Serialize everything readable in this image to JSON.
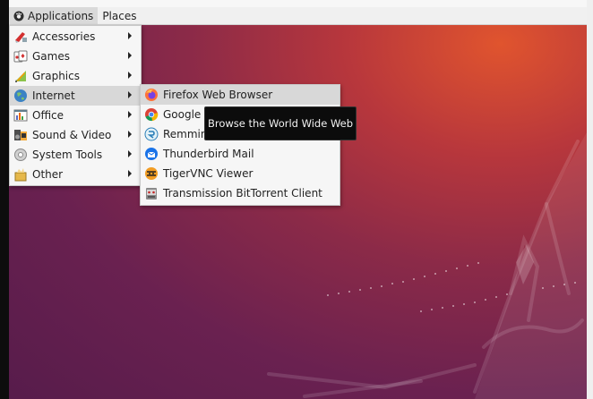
{
  "topbar": {
    "menus": [
      {
        "label": "Applications",
        "active": true
      },
      {
        "label": "Places",
        "active": false
      }
    ]
  },
  "categories": [
    {
      "label": "Accessories",
      "icon": "accessories-icon"
    },
    {
      "label": "Games",
      "icon": "games-icon"
    },
    {
      "label": "Graphics",
      "icon": "graphics-icon"
    },
    {
      "label": "Internet",
      "icon": "internet-icon",
      "highlighted": true
    },
    {
      "label": "Office",
      "icon": "office-icon"
    },
    {
      "label": "Sound & Video",
      "icon": "sound-video-icon"
    },
    {
      "label": "System Tools",
      "icon": "system-tools-icon"
    },
    {
      "label": "Other",
      "icon": "other-icon"
    }
  ],
  "internet_submenu": [
    {
      "label": "Firefox Web Browser",
      "icon": "firefox-icon",
      "highlighted": true
    },
    {
      "label": "Google Chrome",
      "icon": "chrome-icon"
    },
    {
      "label": "Remmina",
      "icon": "remmina-icon"
    },
    {
      "label": "Thunderbird Mail",
      "icon": "thunderbird-icon"
    },
    {
      "label": "TigerVNC Viewer",
      "icon": "tigervnc-icon"
    },
    {
      "label": "Transmission BitTorrent Client",
      "icon": "transmission-icon"
    }
  ],
  "tooltip": {
    "text": "Browse the World Wide Web"
  },
  "colors": {
    "wallpaper_top": "#e0542e",
    "wallpaper_bottom": "#571c4b",
    "menu_bg": "#f6f6f6",
    "highlight": "#d8d8d8"
  }
}
